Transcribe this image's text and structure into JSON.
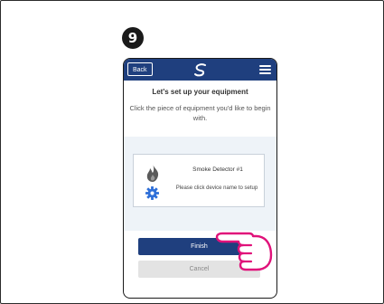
{
  "step": {
    "number": "9"
  },
  "app": {
    "back_label": "Back",
    "title": "Let's set up your equipment",
    "subtitle": "Click the piece of equipment you'd like to begin with."
  },
  "device": {
    "name": "Smoke Detector #1",
    "hint": "Please click device name to setup"
  },
  "buttons": {
    "finish": "Finish",
    "cancel": "Cancel"
  },
  "icons": {
    "logo": "swirl-logo-icon",
    "menu": "hamburger-menu-icon",
    "device": "flame-icon",
    "settings": "gear-icon",
    "pointer": "pointing-hand-icon"
  },
  "colors": {
    "header": "#1f3f7e",
    "accent_blue": "#2e6fd8",
    "pointer": "#e0127a",
    "list_background": "#eef3f8"
  }
}
